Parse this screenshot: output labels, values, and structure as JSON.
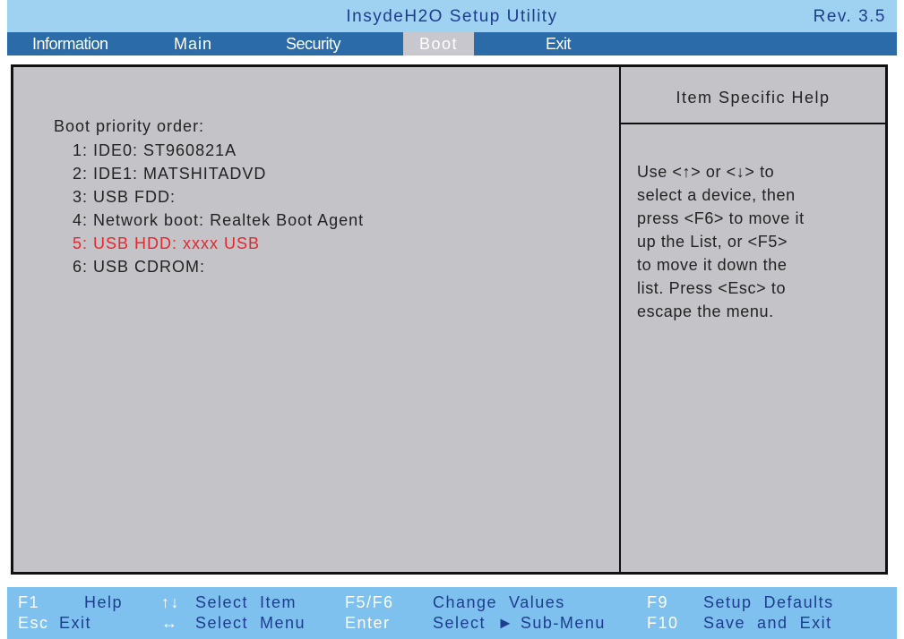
{
  "title_bar": {
    "title": "InsydeH2O Setup Utility",
    "revision": "Rev. 3.5"
  },
  "menu": {
    "items": [
      {
        "label": "Information"
      },
      {
        "label": "Main"
      },
      {
        "label": "Security"
      },
      {
        "label": "Boot",
        "active": true
      },
      {
        "label": "Exit"
      }
    ]
  },
  "boot": {
    "heading": "Boot priority order:",
    "items": [
      "1: IDE0: ST960821A",
      "2: IDE1: MATSHITADVD",
      "3: USB FDD:",
      "4: Network boot: Realtek Boot Agent",
      "5: USB HDD: xxxx USB",
      "6: USB CDROM:"
    ],
    "selected_index": 4
  },
  "help": {
    "title": "Item Specific Help",
    "body": "Use <↑> or <↓> to\nselect a device, then\npress <F6> to move it\nup the List, or <F5>\nto move it down the\nlist. Press <Esc> to\nescape the menu."
  },
  "footer": {
    "row1": [
      {
        "key": "F1",
        "desc": "Help"
      },
      {
        "key": "↑↓",
        "desc": "Select  Item"
      },
      {
        "key": "F5/F6",
        "desc": "Change  Values"
      },
      {
        "key": "F9",
        "desc": "Setup  Defaults"
      }
    ],
    "row2": [
      {
        "key": "Esc",
        "desc": "Exit"
      },
      {
        "key": "↔",
        "desc": "Select  Menu"
      },
      {
        "key": "Enter",
        "desc": "Select  ► Sub-Menu"
      },
      {
        "key": "F10",
        "desc": "Save  and  Exit"
      }
    ]
  },
  "colors": {
    "title_bar": "#9fd2f1",
    "menu_bar": "#2b6ba7",
    "panel": "#c4c4c8",
    "selected_item": "#e8262b",
    "footer": "#7ec0ee",
    "footer_key": "#ffffff",
    "footer_desc": "#1d3d8f"
  },
  "icons": {
    "up_down_arrows": "up-down-arrows-icon",
    "left_right_arrow": "left-right-arrow-icon",
    "submenu_pointer": "right-triangle-icon"
  }
}
